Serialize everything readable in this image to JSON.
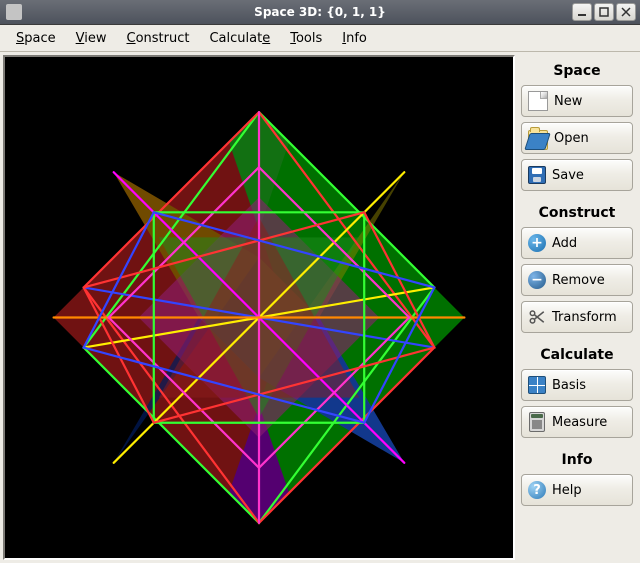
{
  "window": {
    "title": "Space 3D: {0, 1, 1}"
  },
  "menubar": {
    "items": [
      {
        "label": "Space",
        "mnemonic": "S"
      },
      {
        "label": "View",
        "mnemonic": "V"
      },
      {
        "label": "Construct",
        "mnemonic": "C"
      },
      {
        "label": "Calculate",
        "mnemonic": "e"
      },
      {
        "label": "Tools",
        "mnemonic": "T"
      },
      {
        "label": "Info",
        "mnemonic": "I"
      }
    ]
  },
  "sidebar": {
    "sections": [
      {
        "heading": "Space",
        "buttons": [
          {
            "icon": "file-new-icon",
            "label": "New"
          },
          {
            "icon": "folder-open-icon",
            "label": "Open"
          },
          {
            "icon": "floppy-save-icon",
            "label": "Save"
          }
        ]
      },
      {
        "heading": "Construct",
        "buttons": [
          {
            "icon": "plus-circle-icon",
            "label": "Add"
          },
          {
            "icon": "minus-circle-icon",
            "label": "Remove"
          },
          {
            "icon": "scissors-icon",
            "label": "Transform"
          }
        ]
      },
      {
        "heading": "Calculate",
        "buttons": [
          {
            "icon": "grid-icon",
            "label": "Basis"
          },
          {
            "icon": "calculator-icon",
            "label": "Measure"
          }
        ]
      },
      {
        "heading": "Info",
        "buttons": [
          {
            "icon": "help-circle-icon",
            "label": "Help"
          }
        ]
      }
    ]
  },
  "viewport": {
    "description": "Compound polyhedron rendered on black background with translucent red, green, blue, yellow, magenta and orange faces and bright wireframe edges.",
    "background": "#000000"
  }
}
